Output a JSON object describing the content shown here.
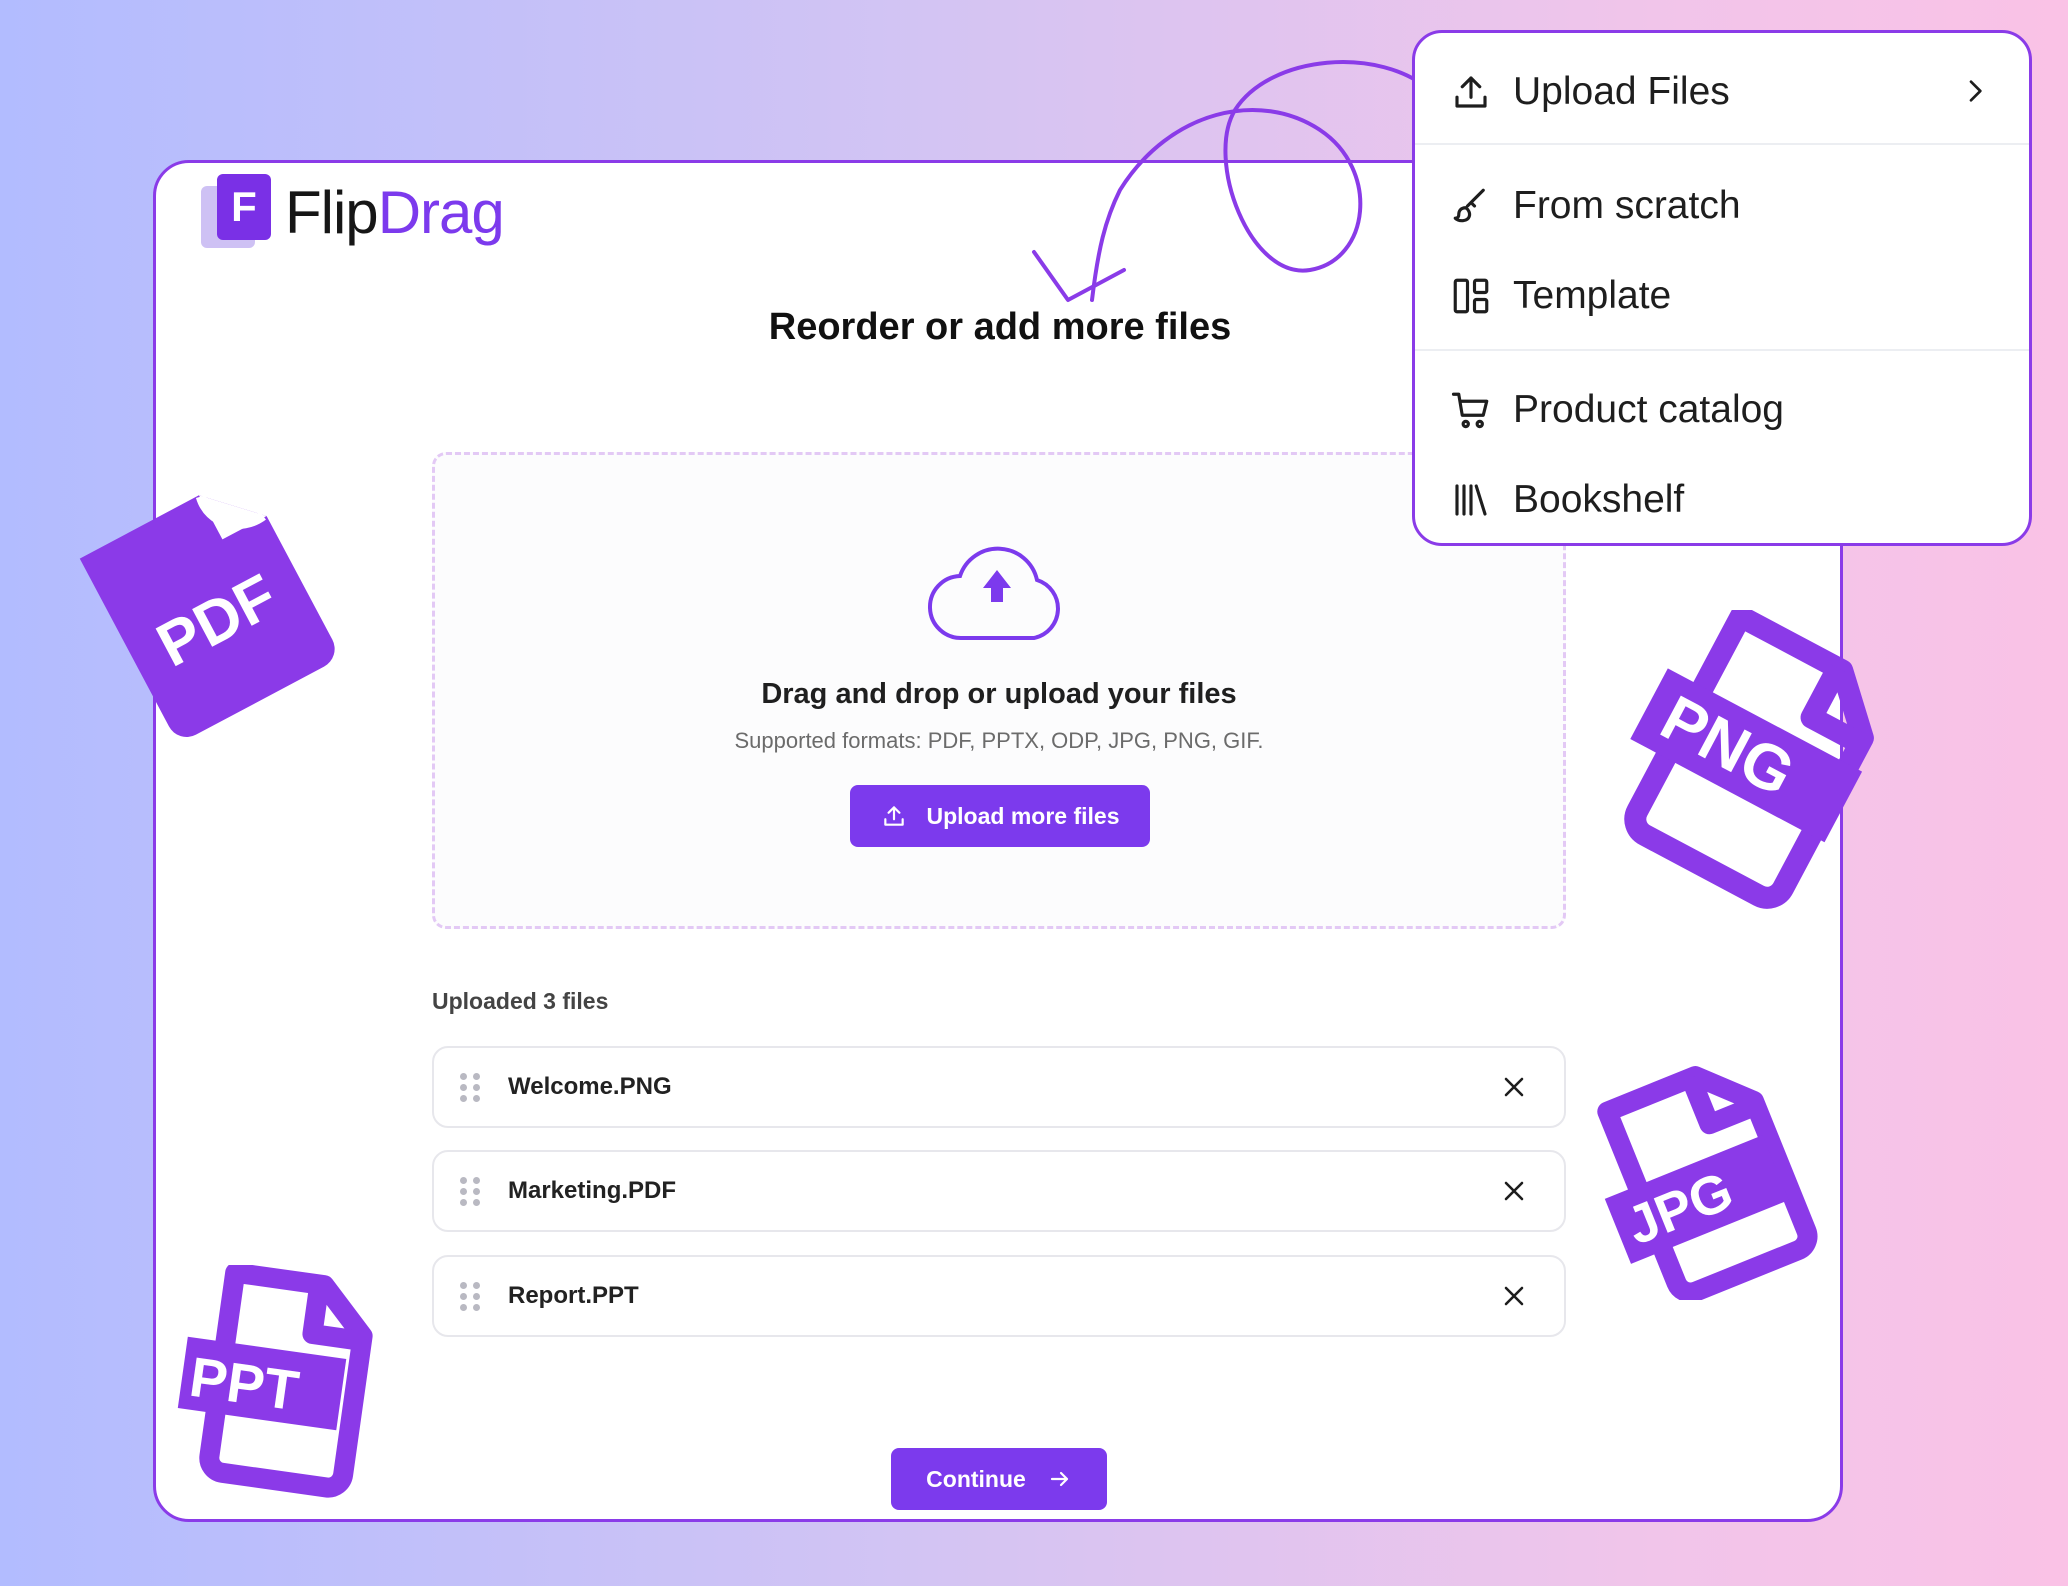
{
  "brand": {
    "logo_letter": "F",
    "name_part1": "Flip",
    "name_part2": "Drag"
  },
  "main": {
    "title": "Reorder or add more files",
    "dropzone": {
      "heading": "Drag and drop or upload your files",
      "formats": "Supported formats: PDF, PPTX, ODP, JPG, PNG, GIF.",
      "upload_button": "Upload more files"
    },
    "uploaded_label": "Uploaded 3 files",
    "files": [
      {
        "name": "Welcome.PNG"
      },
      {
        "name": "Marketing.PDF"
      },
      {
        "name": "Report.PPT"
      }
    ],
    "continue_button": "Continue"
  },
  "menu": {
    "items": [
      {
        "label": "Upload Files",
        "icon": "upload-icon"
      },
      {
        "label": "From scratch",
        "icon": "brush-icon"
      },
      {
        "label": "Template",
        "icon": "layout-icon"
      },
      {
        "label": "Product catalog",
        "icon": "cart-icon"
      },
      {
        "label": "Bookshelf",
        "icon": "books-icon"
      }
    ]
  },
  "decorations": {
    "pdf": "PDF",
    "png": "PNG",
    "jpg": "JPG",
    "ppt": "PPT"
  },
  "colors": {
    "accent": "#7c3aed",
    "card_border": "#8a3be8"
  }
}
